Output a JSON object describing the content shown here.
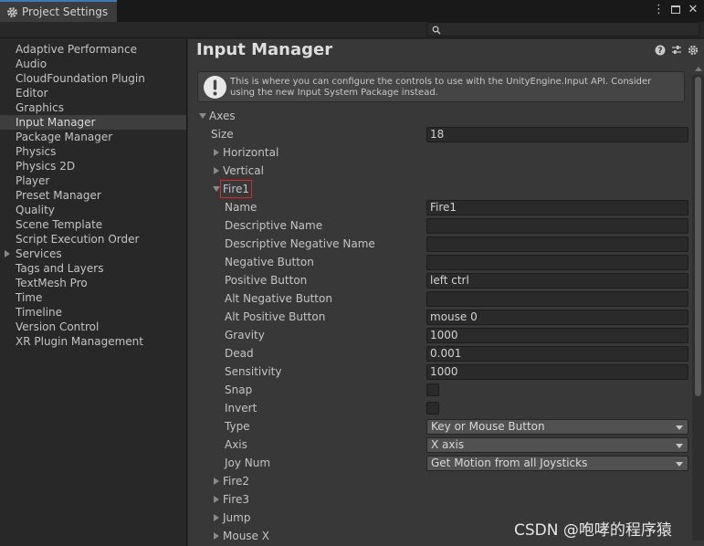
{
  "window": {
    "tab_title": "Project Settings",
    "controls": [
      "more-icon",
      "maximize-icon",
      "close-icon"
    ]
  },
  "search": {
    "placeholder": ""
  },
  "sidebar": {
    "items": [
      {
        "label": "Adaptive Performance",
        "selected": false,
        "expandable": false
      },
      {
        "label": "Audio",
        "selected": false,
        "expandable": false
      },
      {
        "label": "CloudFoundation Plugin",
        "selected": false,
        "expandable": false
      },
      {
        "label": "Editor",
        "selected": false,
        "expandable": false
      },
      {
        "label": "Graphics",
        "selected": false,
        "expandable": false
      },
      {
        "label": "Input Manager",
        "selected": true,
        "expandable": false
      },
      {
        "label": "Package Manager",
        "selected": false,
        "expandable": false
      },
      {
        "label": "Physics",
        "selected": false,
        "expandable": false
      },
      {
        "label": "Physics 2D",
        "selected": false,
        "expandable": false
      },
      {
        "label": "Player",
        "selected": false,
        "expandable": false
      },
      {
        "label": "Preset Manager",
        "selected": false,
        "expandable": false
      },
      {
        "label": "Quality",
        "selected": false,
        "expandable": false
      },
      {
        "label": "Scene Template",
        "selected": false,
        "expandable": false
      },
      {
        "label": "Script Execution Order",
        "selected": false,
        "expandable": false
      },
      {
        "label": "Services",
        "selected": false,
        "expandable": true
      },
      {
        "label": "Tags and Layers",
        "selected": false,
        "expandable": false
      },
      {
        "label": "TextMesh Pro",
        "selected": false,
        "expandable": false
      },
      {
        "label": "Time",
        "selected": false,
        "expandable": false
      },
      {
        "label": "Timeline",
        "selected": false,
        "expandable": false
      },
      {
        "label": "Version Control",
        "selected": false,
        "expandable": false
      },
      {
        "label": "XR Plugin Management",
        "selected": false,
        "expandable": false
      }
    ]
  },
  "main": {
    "title": "Input Manager",
    "header_icons": [
      "help-icon",
      "preset-icon",
      "settings-gear-icon"
    ],
    "help_text": "This is where you can configure the controls to use with the UnityEngine.Input API. Consider using the new Input System Package instead.",
    "axes_label": "Axes",
    "size_label": "Size",
    "size_value": "18",
    "collapsed_axes_before": [
      "Horizontal",
      "Vertical"
    ],
    "expanded_axis": {
      "label": "Fire1",
      "fields": {
        "name": {
          "label": "Name",
          "value": "Fire1"
        },
        "descriptive_name": {
          "label": "Descriptive Name",
          "value": ""
        },
        "descriptive_negative_name": {
          "label": "Descriptive Negative Name",
          "value": ""
        },
        "negative_button": {
          "label": "Negative Button",
          "value": ""
        },
        "positive_button": {
          "label": "Positive Button",
          "value": "left ctrl"
        },
        "alt_negative_button": {
          "label": "Alt Negative Button",
          "value": ""
        },
        "alt_positive_button": {
          "label": "Alt Positive Button",
          "value": "mouse 0"
        },
        "gravity": {
          "label": "Gravity",
          "value": "1000"
        },
        "dead": {
          "label": "Dead",
          "value": "0.001"
        },
        "sensitivity": {
          "label": "Sensitivity",
          "value": "1000"
        },
        "snap": {
          "label": "Snap",
          "checked": false
        },
        "invert": {
          "label": "Invert",
          "checked": false
        },
        "type": {
          "label": "Type",
          "value": "Key or Mouse Button"
        },
        "axis": {
          "label": "Axis",
          "value": "X axis"
        },
        "joy_num": {
          "label": "Joy Num",
          "value": "Get Motion from all Joysticks"
        }
      }
    },
    "collapsed_axes_after": [
      "Fire2",
      "Fire3",
      "Jump",
      "Mouse X"
    ]
  },
  "watermark": "CSDN @咆哮的程序猿",
  "colors": {
    "selection_outline": "#e0262d",
    "tab_accent": "#3a79bb"
  }
}
